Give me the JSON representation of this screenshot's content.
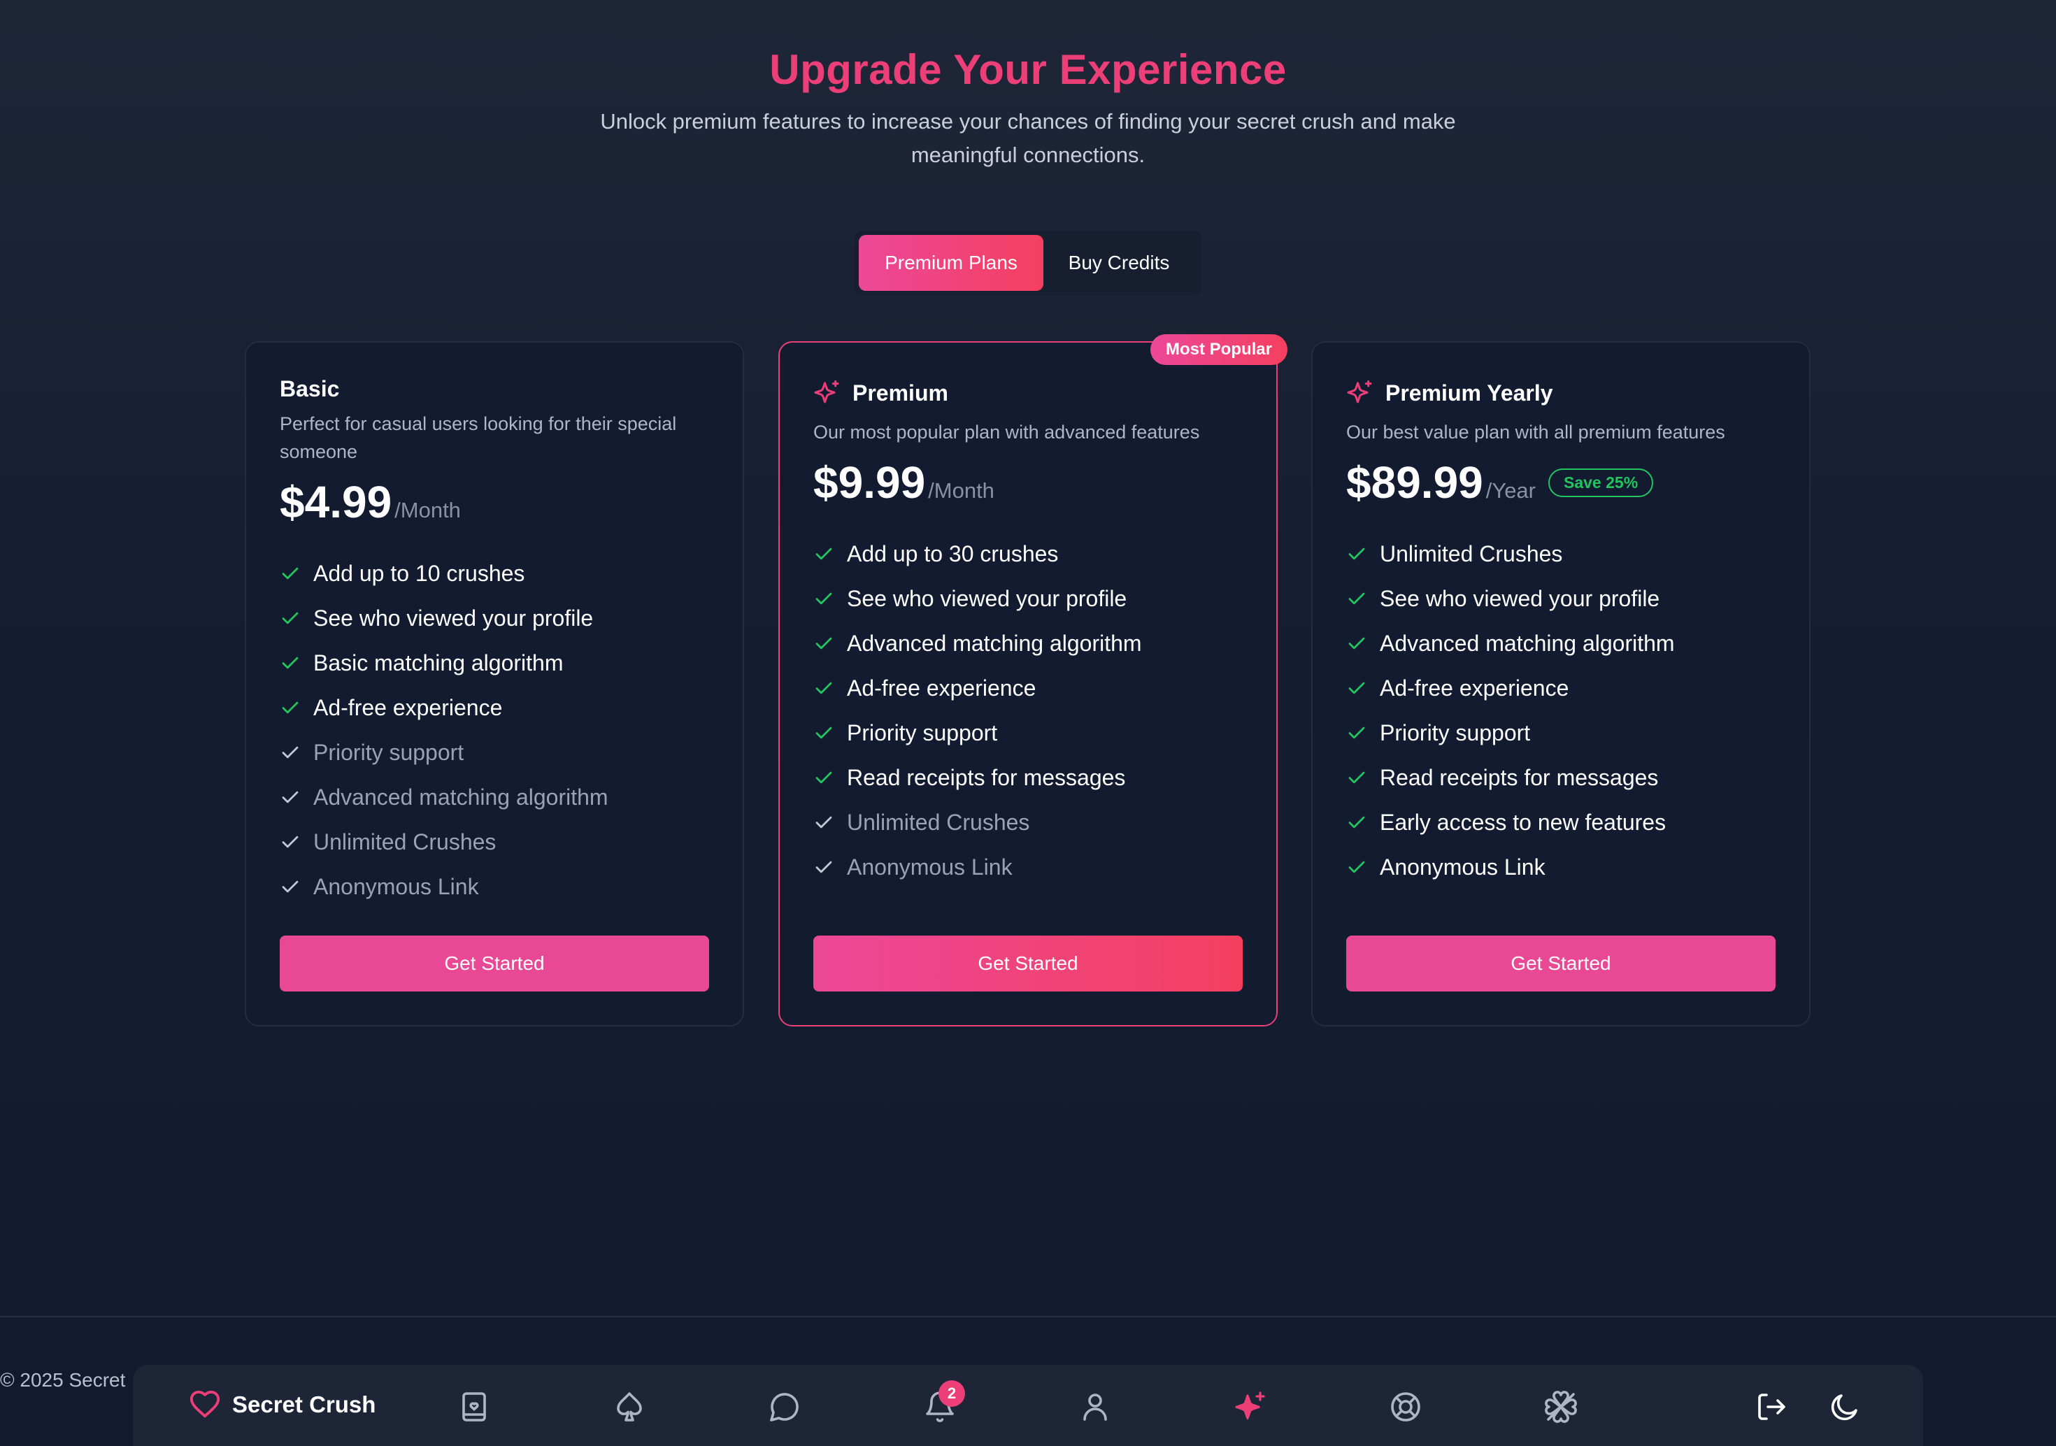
{
  "header": {
    "title": "Upgrade Your Experience",
    "subtitle": "Unlock premium features to increase your chances of finding your secret crush and make meaningful connections."
  },
  "tabs": [
    {
      "label": "Premium Plans",
      "active": true
    },
    {
      "label": "Buy Credits",
      "active": false
    }
  ],
  "plans": [
    {
      "name": "Basic",
      "description": "Perfect for casual users looking for their special someone",
      "price": "$4.99",
      "period": "/Month",
      "features": [
        {
          "text": "Add up to 10 crushes",
          "included": true
        },
        {
          "text": "See who viewed your profile",
          "included": true
        },
        {
          "text": "Basic matching algorithm",
          "included": true
        },
        {
          "text": "Ad-free experience",
          "included": true
        },
        {
          "text": "Priority support",
          "included": false
        },
        {
          "text": "Advanced matching algorithm",
          "included": false
        },
        {
          "text": "Unlimited Crushes",
          "included": false
        },
        {
          "text": "Anonymous Link",
          "included": false
        }
      ],
      "cta": "Get Started"
    },
    {
      "name": "Premium",
      "badge": "Most Popular",
      "description": "Our most popular plan with advanced features",
      "price": "$9.99",
      "period": "/Month",
      "features": [
        {
          "text": "Add up to 30 crushes",
          "included": true
        },
        {
          "text": "See who viewed your profile",
          "included": true
        },
        {
          "text": "Advanced matching algorithm",
          "included": true
        },
        {
          "text": "Ad-free experience",
          "included": true
        },
        {
          "text": "Priority support",
          "included": true
        },
        {
          "text": "Read receipts for messages",
          "included": true
        },
        {
          "text": "Unlimited Crushes",
          "included": false
        },
        {
          "text": "Anonymous Link",
          "included": false
        }
      ],
      "cta": "Get Started"
    },
    {
      "name": "Premium Yearly",
      "description": "Our best value plan with all premium features",
      "price": "$89.99",
      "period": "/Year",
      "save": "Save 25%",
      "features": [
        {
          "text": "Unlimited Crushes",
          "included": true
        },
        {
          "text": "See who viewed your profile",
          "included": true
        },
        {
          "text": "Advanced matching algorithm",
          "included": true
        },
        {
          "text": "Ad-free experience",
          "included": true
        },
        {
          "text": "Priority support",
          "included": true
        },
        {
          "text": "Read receipts for messages",
          "included": true
        },
        {
          "text": "Early access to new features",
          "included": true
        },
        {
          "text": "Anonymous Link",
          "included": true
        }
      ],
      "cta": "Get Started"
    }
  ],
  "footer": {
    "copyright": "© 2025 Secret"
  },
  "nav": {
    "brand": "Secret Crush",
    "notification_count": "2",
    "icons": [
      "heart-icon",
      "book-icon",
      "spade-icon",
      "chat-icon",
      "bell-icon",
      "user-icon",
      "sparkle-icon",
      "lifebuoy-icon",
      "clover-icon",
      "logout-icon",
      "moon-icon"
    ]
  },
  "colors": {
    "accent": "#ec3f78",
    "check_included": "#22c55e",
    "check_excluded": "#c3c9d5",
    "background": "#161d31"
  }
}
